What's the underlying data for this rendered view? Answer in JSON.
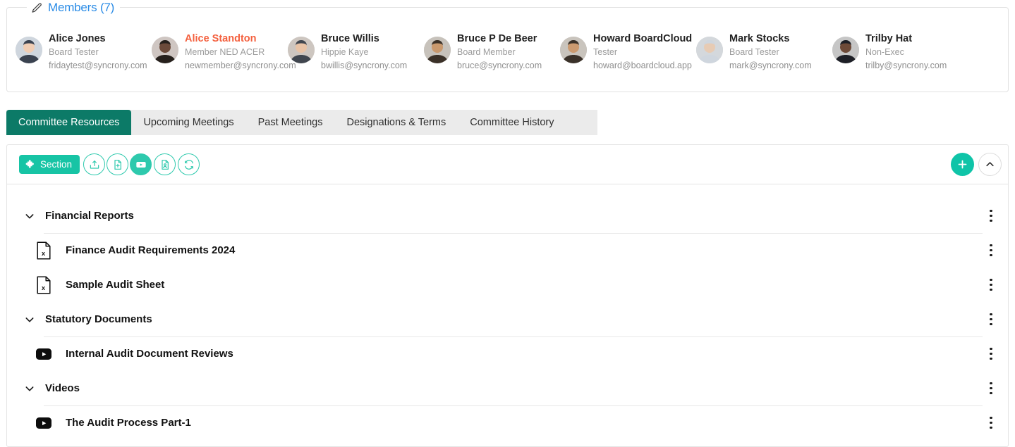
{
  "members_panel": {
    "legend_label": "Members (7)",
    "edit_icon": "pencil-icon",
    "members": [
      {
        "name": "Alice Jones",
        "role": "Board Tester",
        "email": "fridaytest@syncrony.com",
        "highlight": false
      },
      {
        "name": "Alice Standton",
        "role": "Member NED ACER",
        "email": "newmember@syncrony.com",
        "highlight": true
      },
      {
        "name": "Bruce Willis",
        "role": "Hippie Kaye",
        "email": "bwillis@syncrony.com",
        "highlight": false
      },
      {
        "name": "Bruce P De Beer",
        "role": "Board Member",
        "email": "bruce@syncrony.com",
        "highlight": false
      },
      {
        "name": "Howard BoardCloud",
        "role": "Tester",
        "email": "howard@boardcloud.app",
        "highlight": false
      },
      {
        "name": "Mark Stocks",
        "role": "Board Tester",
        "email": "mark@syncrony.com",
        "highlight": false
      },
      {
        "name": "Trilby Hat",
        "role": "Non-Exec",
        "email": "trilby@syncrony.com",
        "highlight": false
      }
    ]
  },
  "tabs": [
    {
      "label": "Committee Resources",
      "active": true
    },
    {
      "label": "Upcoming Meetings",
      "active": false
    },
    {
      "label": "Past Meetings",
      "active": false
    },
    {
      "label": "Designations & Terms",
      "active": false
    },
    {
      "label": "Committee History",
      "active": false
    }
  ],
  "toolbar": {
    "section_label": "Section",
    "section_icon": "puzzle-piece-icon",
    "actions": [
      {
        "icon": "upload-icon",
        "title": "Upload"
      },
      {
        "icon": "new-document-icon",
        "title": "New Document"
      },
      {
        "icon": "video-icon",
        "title": "Add Video"
      },
      {
        "icon": "document-person-icon",
        "title": "Add Profile Document"
      },
      {
        "icon": "refresh-icon",
        "title": "Refresh"
      }
    ],
    "add_icon": "plus-icon",
    "collapse_icon": "chevron-up-icon",
    "kebab_icon": "kebab-menu-icon",
    "expand_icon": "chevron-down-icon"
  },
  "resources": [
    {
      "type": "group",
      "label": "Financial Reports",
      "icon": "chevron-down-icon",
      "expanded": true
    },
    {
      "type": "file",
      "label": "Finance Audit Requirements 2024",
      "icon": "excel-file-icon"
    },
    {
      "type": "file",
      "label": "Sample Audit Sheet",
      "icon": "excel-file-icon"
    },
    {
      "type": "group",
      "label": "Statutory Documents",
      "icon": "chevron-down-icon",
      "expanded": true
    },
    {
      "type": "file",
      "label": "Internal Audit Document Reviews",
      "icon": "video-play-icon"
    },
    {
      "type": "group",
      "label": "Videos",
      "icon": "chevron-down-icon",
      "expanded": true
    },
    {
      "type": "file",
      "label": "The Audit Process Part-1",
      "icon": "video-play-icon"
    }
  ],
  "colors": {
    "accent_teal": "#17c4a5",
    "active_tab": "#0c7a67",
    "link_blue": "#2b8ce6",
    "highlight_orange": "#f4603e",
    "tabbar_bg": "#ebebeb"
  }
}
